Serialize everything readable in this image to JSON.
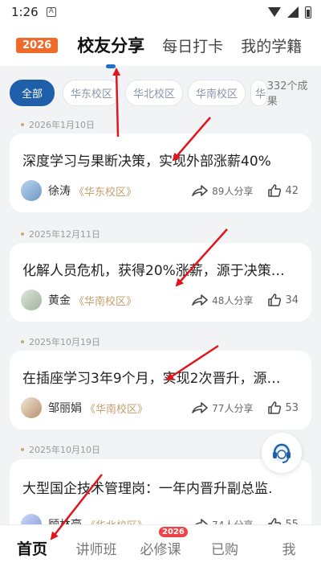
{
  "status": {
    "time": "1:26",
    "notif_icon": "A"
  },
  "header": {
    "year_badge": "2026",
    "tabs": [
      {
        "label": "校友分享",
        "active": true
      },
      {
        "label": "每日打卡"
      },
      {
        "label": "我的学籍"
      }
    ]
  },
  "filters": {
    "chips": [
      "全部",
      "华东校区",
      "华北校区",
      "华南校区",
      "华"
    ],
    "count": "332个成果"
  },
  "posts": [
    {
      "date": "2026年1月10日",
      "title": "深度学习与果断决策，实现外部涨薪40%",
      "name": "徐涛",
      "campus": "《华东校区》",
      "shares": "89人分享",
      "likes": "42"
    },
    {
      "date": "2025年12月11日",
      "title": "化解人员危机，获得20%涨薪，源于决策…",
      "name": "黄金",
      "campus": "《华南校区》",
      "shares": "48人分享",
      "likes": "34"
    },
    {
      "date": "2025年10月19日",
      "title": "在插座学习3年9个月，实现2次晋升，源…",
      "name": "邹丽娟",
      "campus": "《华南校区》",
      "shares": "77人分享",
      "likes": "53"
    },
    {
      "date": "2025年10月10日",
      "title": "大型国企技术管理岗：一年内晋升副总监…",
      "name": "顾林豪",
      "campus": "《华北校区》",
      "shares": "74人分享",
      "likes": "55"
    }
  ],
  "bottom_nav": [
    {
      "label": "首页",
      "active": true
    },
    {
      "label": "讲师班"
    },
    {
      "label": "必修课",
      "badge": "2026"
    },
    {
      "label": "已购"
    },
    {
      "label": "我"
    }
  ],
  "icons": {
    "share": "share-arrow-icon",
    "like": "thumbs-up-icon",
    "support": "customer-service-headset-icon"
  },
  "colors": {
    "accent": "#1f5ea8",
    "badge_orange": "#f06a2a",
    "badge_red": "#f04348",
    "campus_gold": "#c4a06f",
    "annotation_red": "#e0161c"
  }
}
